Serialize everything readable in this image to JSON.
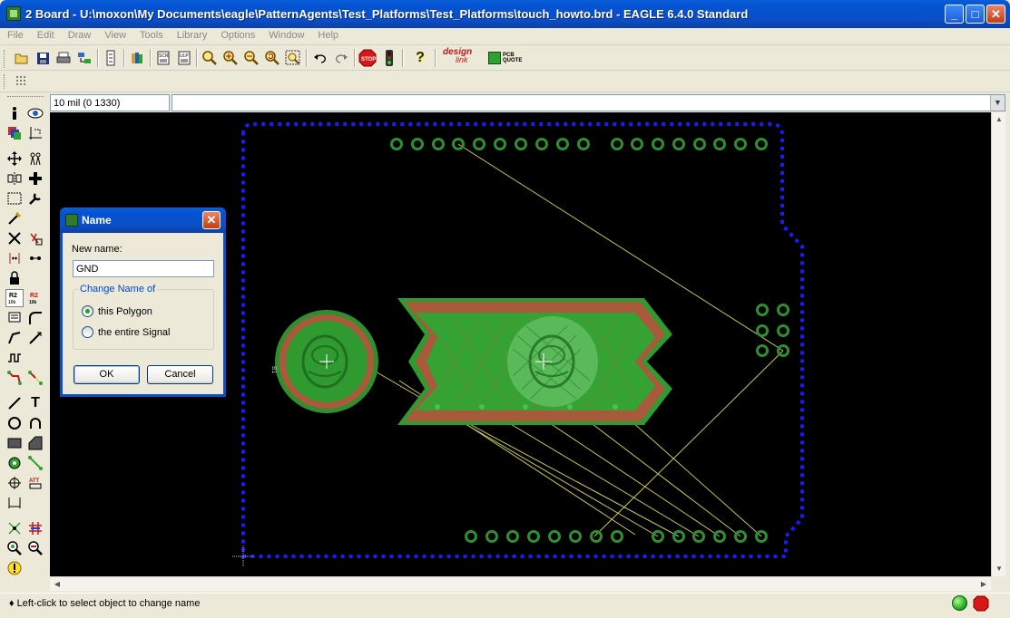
{
  "window": {
    "title": "2 Board - U:\\moxon\\My Documents\\eagle\\PatternAgents\\Test_Platforms\\Test_Platforms\\touch_howto.brd - EAGLE 6.4.0 Standard",
    "minimize": "_",
    "maximize": "□",
    "close": "✕"
  },
  "menu": [
    "File",
    "Edit",
    "Draw",
    "View",
    "Tools",
    "Library",
    "Options",
    "Window",
    "Help"
  ],
  "toolbar": {
    "icons": [
      "open-icon",
      "save-icon",
      "print-icon",
      "cam-icon",
      "switch-schematic-icon",
      "use-library-icon",
      "script-icon",
      "ulp-icon",
      "zoom-fit-icon",
      "zoom-in-icon",
      "zoom-out-icon",
      "zoom-redraw-icon",
      "zoom-select-icon",
      "undo-icon",
      "redo-icon",
      "stop-icon",
      "go-icon",
      "help-icon",
      "designlink-icon",
      "pcb-quote-icon"
    ],
    "stop_label": "STOP",
    "designlink_label_1": "design",
    "designlink_label_2": "link",
    "pcb_quote_label_1": "PCB",
    "pcb_quote_label_2": "QUOTE"
  },
  "coordinates": "10 mil (0 1330)",
  "command_line": "",
  "board": {
    "pad_label": "B1",
    "colors": {
      "background": "#000000",
      "outline": "#1a1aff",
      "pad": "#2f8f2f",
      "polygon": "#2f9a2f",
      "copper_red": "#a85a3a",
      "airwire": "#c8c850"
    }
  },
  "dialog": {
    "title": "Name",
    "close": "✕",
    "new_name_label": "New name:",
    "new_name_value": "GND",
    "group_title": "Change Name of",
    "options": [
      {
        "label": "this Polygon",
        "selected": true
      },
      {
        "label": "the entire Signal",
        "selected": false
      }
    ],
    "ok": "OK",
    "cancel": "Cancel"
  },
  "status": {
    "message": "♦ Left-click to select object to change name"
  }
}
